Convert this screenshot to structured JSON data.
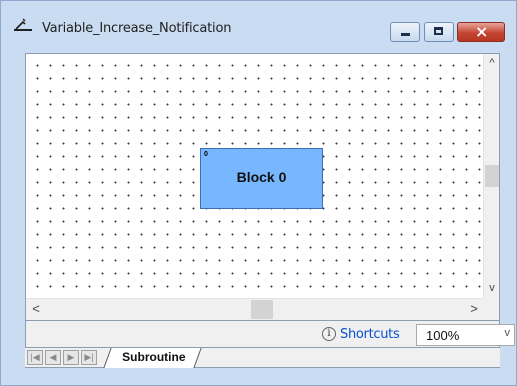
{
  "window": {
    "title": "Variable_Increase_Notification"
  },
  "canvas": {
    "blocks": [
      {
        "index": "0",
        "label": "Block 0",
        "color": "#77b7ff"
      }
    ]
  },
  "scrollbars": {
    "up_glyph": "^",
    "down_glyph": "v",
    "left_glyph": "<",
    "right_glyph": ">"
  },
  "status": {
    "info_glyph": "i",
    "shortcuts_label": "Shortcuts",
    "zoom_value": "100%",
    "zoom_arrow_glyph": "v"
  },
  "tabs": {
    "nav_first": "|◀",
    "nav_prev": "◀",
    "nav_next": "▶",
    "nav_last": "▶|",
    "items": [
      {
        "label": "Subroutine",
        "active": true
      }
    ]
  },
  "colors": {
    "link": "#0b4fcf",
    "close_button": "#c34632"
  }
}
